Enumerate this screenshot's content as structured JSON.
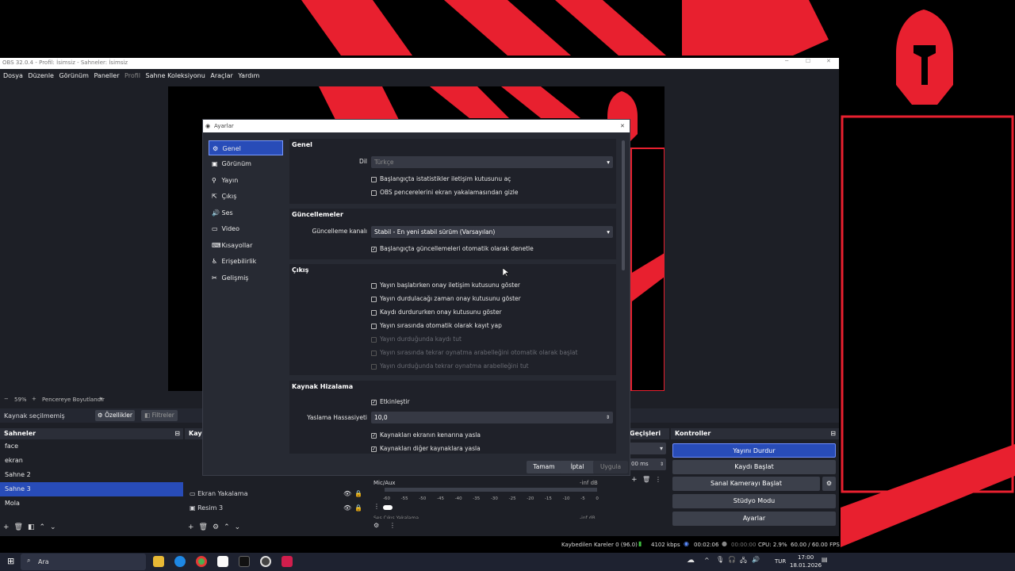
{
  "window": {
    "title": "OBS 32.0.4 - Profil: İsimsiz - Sahneler: İsimsiz"
  },
  "menu": [
    "Dosya",
    "Düzenle",
    "Görünüm",
    "Paneller",
    "Profil",
    "Sahne Koleksiyonu",
    "Araçlar",
    "Yardım"
  ],
  "preview_bar": {
    "zoom": "59%",
    "mode": "Pencereye Boyutlandır"
  },
  "source_bar": {
    "status": "Kaynak seçilmemiş",
    "properties": "Özellikler",
    "filters": "Filtreler"
  },
  "scenes": {
    "title": "Sahneler",
    "items": [
      "face",
      "ekran",
      "Sahne 2",
      "Sahne 3",
      "Mola"
    ],
    "selected": "Sahne 3"
  },
  "sources": {
    "title": "Kay",
    "items": [
      "Ekran Yakalama",
      "Resim 3"
    ]
  },
  "mixer": {
    "channel": "Mic/Aux",
    "level": "-inf dB",
    "scale": [
      "-60",
      "-55",
      "-50",
      "-45",
      "-40",
      "-35",
      "-30",
      "-25",
      "-20",
      "-15",
      "-10",
      "-5",
      "0"
    ],
    "next": "Ses Çıkış Yakalama",
    "next_level": "-inf dB"
  },
  "transitions": {
    "title": "Geçişleri",
    "duration": "00 ms"
  },
  "controls": {
    "title": "Kontroller",
    "stream": "Yayını Durdur",
    "record": "Kaydı Başlat",
    "vcam": "Sanal Kamerayı Başlat",
    "studio": "Stüdyo Modu",
    "settings": "Ayarlar"
  },
  "status": {
    "dropped": "Kaybedilen Kareler 0 (96.0)",
    "bitrate": "4102 kbps",
    "stream_time": "00:02:06",
    "rec_time": "00:00:00",
    "cpu": "CPU: 2.9%",
    "fps": "60.00 / 60.00 FPS"
  },
  "dialog": {
    "title": "Ayarlar",
    "sidebar": [
      "Genel",
      "Görünüm",
      "Yayın",
      "Çıkış",
      "Ses",
      "Video",
      "Kısayollar",
      "Erişebilirlik",
      "Gelişmiş"
    ],
    "selected": "Genel",
    "general": {
      "title": "Genel",
      "lang_label": "Dil",
      "lang_value": "Türkçe",
      "checks": [
        "Başlangıçta istatistikler iletişim kutusunu aç",
        "OBS pencerelerini ekran yakalamasından gizle"
      ]
    },
    "updates": {
      "title": "Güncellemeler",
      "channel_label": "Güncelleme kanalı",
      "channel_value": "Stabil - En yeni stabil sürüm (Varsayılan)",
      "check": "Başlangıçta güncellemeleri otomatik olarak denetle"
    },
    "output": {
      "title": "Çıkış",
      "checks": [
        "Yayın başlatırken onay iletişim kutusunu göster",
        "Yayın durdulacağı zaman onay kutusunu göster",
        "Kaydı durdururken onay kutusunu göster",
        "Yayın sırasında otomatik olarak kayıt yap"
      ],
      "disabled": [
        "Yayın durduğunda kaydı tut",
        "Yayın sırasında tekrar oynatma arabelleğini otomatik olarak başlat",
        "Yayın durduğunda tekrar oynatma arabelleğini tut"
      ]
    },
    "snapping": {
      "title": "Kaynak Hizalama",
      "enable": "Etkinleştir",
      "sens_label": "Yaslama Hassasiyeti",
      "sens_value": "10,0",
      "checks": [
        "Kaynakları ekranın kenarına yasla",
        "Kaynakları diğer kaynaklara yasla"
      ]
    },
    "buttons": {
      "ok": "Tamam",
      "cancel": "İptal",
      "apply": "Uygula"
    }
  },
  "taskbar": {
    "search": "Ara",
    "lang": "TUR",
    "time": "17:00",
    "date": "18.01.2026"
  },
  "colors": {
    "accent": "#284cb8",
    "brand_red": "#e8202f",
    "bg": "#1d1f26"
  }
}
